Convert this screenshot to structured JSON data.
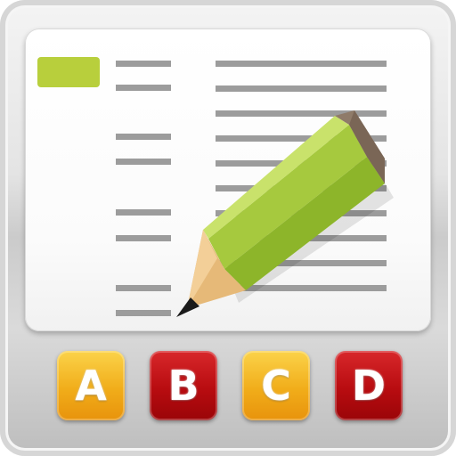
{
  "answers": [
    {
      "label": "A",
      "color": "#f1ad1a"
    },
    {
      "label": "B",
      "color": "#b80c10"
    },
    {
      "label": "C",
      "color": "#f1ad1a"
    },
    {
      "label": "D",
      "color": "#b80c10"
    }
  ],
  "colors": {
    "pencil_body": "#a6c93e",
    "highlight_bar": "#b8cf3c",
    "text_lines": "#9c9c9c"
  }
}
